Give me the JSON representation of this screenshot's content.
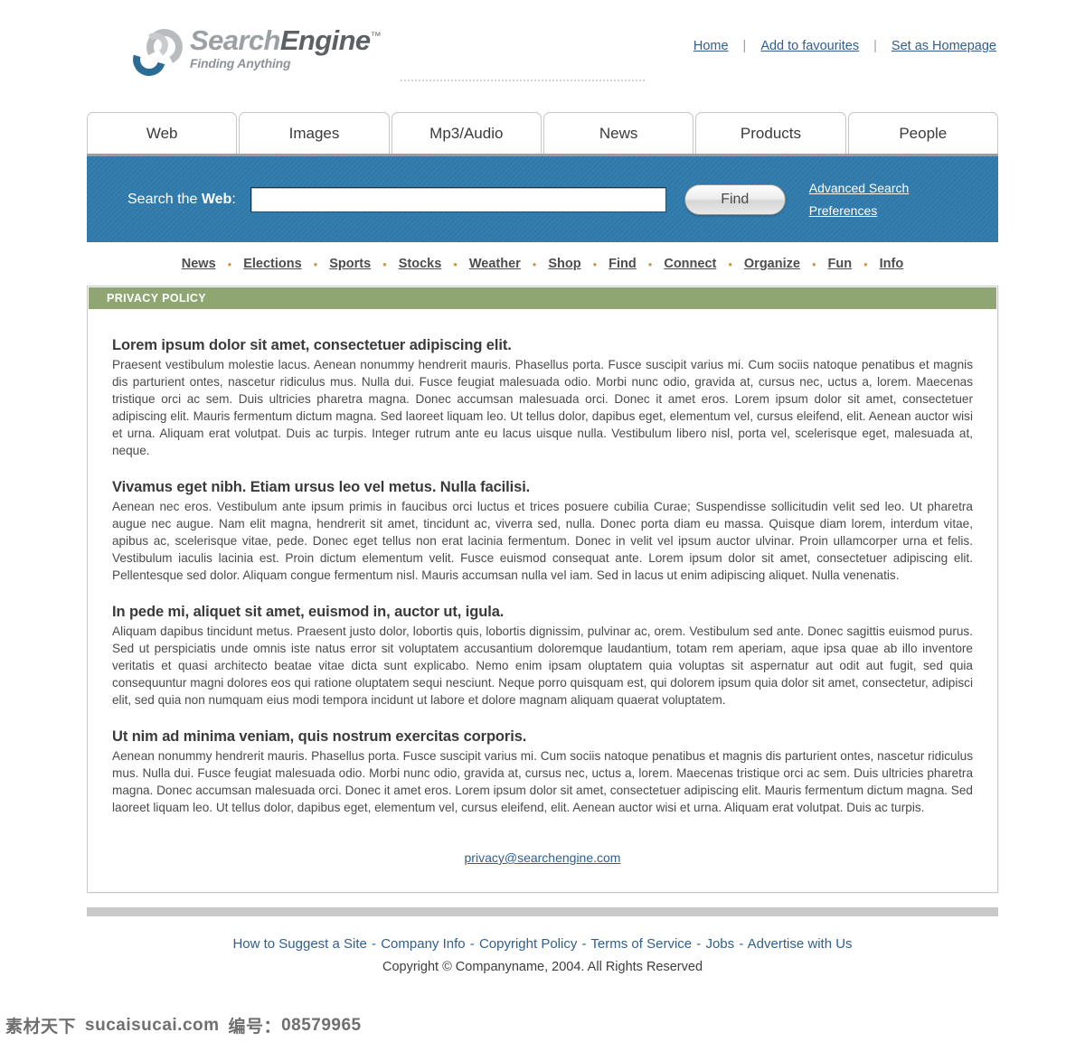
{
  "brand": {
    "name_part1": "Search",
    "name_part2": "Engine",
    "trademark": "™",
    "tagline": "Finding Anything",
    "logo_icon": "two-interlocking-rings-logo",
    "accent_blue": "#2a6c95",
    "accent_gray": "#b9bcbe"
  },
  "top_nav": {
    "links": [
      {
        "label": "Home"
      },
      {
        "label": "Add to favourites"
      },
      {
        "label": "Set as Homepage"
      }
    ],
    "separator": "|"
  },
  "tabs": [
    {
      "label": "Web",
      "active": true
    },
    {
      "label": "Images",
      "active": false
    },
    {
      "label": "Mp3/Audio",
      "active": false
    },
    {
      "label": "News",
      "active": false
    },
    {
      "label": "Products",
      "active": false
    },
    {
      "label": "People",
      "active": false
    }
  ],
  "search": {
    "label_prefix": "Search the ",
    "label_strong": "Web",
    "label_suffix": ":",
    "input_value": "",
    "input_placeholder": "",
    "button_label": "Find",
    "links": [
      {
        "label": "Advanced Search"
      },
      {
        "label": "Preferences"
      }
    ],
    "bar_color": "#2f7aab"
  },
  "sub_nav": {
    "separator": "•",
    "separator_color": "#c69a4a",
    "links": [
      {
        "label": "News"
      },
      {
        "label": "Elections"
      },
      {
        "label": "Sports"
      },
      {
        "label": "Stocks"
      },
      {
        "label": "Weather"
      },
      {
        "label": "Shop"
      },
      {
        "label": "Find"
      },
      {
        "label": "Connect"
      },
      {
        "label": "Organize"
      },
      {
        "label": "Fun"
      },
      {
        "label": "Info"
      }
    ]
  },
  "panel": {
    "header_title": "PRIVACY POLICY",
    "header_color": "#8fa672",
    "sections": [
      {
        "heading": "Lorem ipsum dolor sit amet, consectetuer adipiscing elit.",
        "body": "Praesent vestibulum molestie lacus. Aenean nonummy hendrerit mauris. Phasellus porta. Fusce suscipit varius mi. Cum sociis natoque penatibus et magnis dis parturient ontes, nascetur ridiculus mus. Nulla dui. Fusce feugiat malesuada odio. Morbi nunc odio, gravida at, cursus nec, uctus a, lorem. Maecenas tristique orci ac sem. Duis ultricies pharetra magna. Donec accumsan malesuada orci. Donec it amet eros. Lorem ipsum dolor sit amet, consectetuer adipiscing elit. Mauris fermentum dictum magna. Sed laoreet liquam leo. Ut tellus dolor, dapibus eget, elementum vel, cursus eleifend, elit. Aenean auctor wisi et urna. Aliquam erat volutpat. Duis ac turpis. Integer rutrum ante eu lacus uisque nulla. Vestibulum libero nisl, porta vel, scelerisque eget, malesuada at, neque."
      },
      {
        "heading": "Vivamus eget nibh. Etiam ursus leo vel metus. Nulla facilisi.",
        "body": "Aenean nec eros. Vestibulum ante ipsum primis in faucibus orci luctus et trices posuere cubilia Curae; Suspendisse sollicitudin velit sed leo. Ut pharetra augue nec augue. Nam elit magna, hendrerit sit amet, tincidunt ac, viverra sed, nulla. Donec porta diam eu massa. Quisque diam lorem, interdum vitae, apibus ac, scelerisque vitae, pede. Donec eget tellus non erat lacinia fermentum. Donec in velit vel ipsum auctor ulvinar. Proin ullamcorper urna et felis. Vestibulum iaculis lacinia est. Proin dictum elementum velit. Fusce euismod consequat ante. Lorem ipsum dolor sit amet, consectetuer adipiscing elit. Pellentesque sed dolor. Aliquam congue fermentum nisl. Mauris accumsan nulla vel iam. Sed in lacus ut enim adipiscing aliquet. Nulla venenatis."
      },
      {
        "heading": "In pede mi, aliquet sit amet, euismod in, auctor ut, igula.",
        "body": "Aliquam dapibus tincidunt metus. Praesent justo dolor, lobortis quis, lobortis dignissim, pulvinar ac, orem. Vestibulum sed ante. Donec sagittis euismod purus. Sed ut perspiciatis unde omnis iste natus error sit voluptatem accusantium doloremque laudantium, totam rem aperiam, aque ipsa quae ab illo inventore veritatis et quasi architecto beatae vitae dicta sunt explicabo. Nemo enim ipsam oluptatem quia voluptas sit aspernatur aut odit aut fugit, sed quia consequuntur magni dolores eos qui ratione oluptatem sequi nesciunt. Neque porro quisquam est, qui dolorem ipsum quia dolor sit amet, consectetur, adipisci elit, sed quia non numquam eius modi tempora incidunt ut labore et dolore magnam aliquam quaerat voluptatem."
      },
      {
        "heading": "Ut nim ad minima veniam, quis nostrum exercitas corporis.",
        "body": "Aenean nonummy hendrerit mauris. Phasellus porta. Fusce suscipit varius mi. Cum sociis natoque penatibus et magnis dis parturient ontes, nascetur ridiculus mus. Nulla dui. Fusce feugiat malesuada odio. Morbi nunc odio, gravida at, cursus nec, uctus a, lorem. Maecenas tristique orci ac sem. Duis ultricies pharetra magna. Donec accumsan malesuada orci. Donec it amet eros. Lorem ipsum dolor sit amet, consectetuer adipiscing elit. Mauris fermentum dictum magna. Sed laoreet liquam leo. Ut tellus dolor, dapibus eget, elementum vel, cursus eleifend, elit. Aenean auctor wisi et urna. Aliquam erat volutpat. Duis ac turpis."
      }
    ],
    "contact_email": "privacy@searchengine.com"
  },
  "footer": {
    "links": [
      {
        "label": "How to Suggest a Site"
      },
      {
        "label": "Company Info"
      },
      {
        "label": "Copyright Policy"
      },
      {
        "label": "Terms of Service"
      },
      {
        "label": "Jobs"
      },
      {
        "label": "Advertise with Us"
      }
    ],
    "separator": "-",
    "copyright": "Copyright © Companyname, 2004. All Rights Reserved"
  },
  "watermark": {
    "site_cn": "素材天下",
    "site_url": "sucaisucai.com",
    "id_label": "编号：",
    "id_value": "08579965"
  }
}
